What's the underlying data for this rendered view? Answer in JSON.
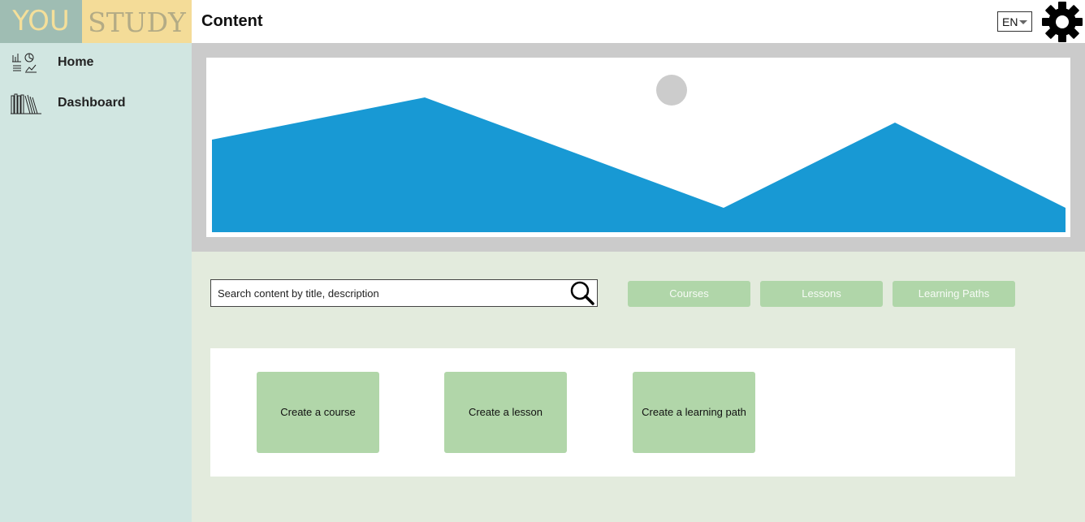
{
  "brand": {
    "part1": "YOU",
    "part2": "STUDY"
  },
  "header": {
    "title": "Content",
    "language": "EN",
    "settings_icon": "gear-icon"
  },
  "sidebar": {
    "items": [
      {
        "label": "Home",
        "icon": "home-charts-icon"
      },
      {
        "label": "Dashboard",
        "icon": "bookshelf-icon"
      }
    ]
  },
  "banner": {
    "icon": "image-placeholder-icon",
    "colors": {
      "frame": "#cbcbcb",
      "mountains": "#1899d4",
      "sun": "#cccccc"
    }
  },
  "search": {
    "placeholder": "Search content by title, description",
    "value": "",
    "icon": "search-icon"
  },
  "filters": [
    "Courses",
    "Lessons",
    "Learning Paths"
  ],
  "create_actions": [
    "Create a course",
    "Create a lesson",
    "Create a learning path"
  ],
  "colors": {
    "sidebar_bg": "#d1e6e1",
    "main_bg": "#e3ebdd",
    "button_green": "#b0d6a9",
    "logo_you_bg": "#9fbdb3",
    "logo_study_bg": "#f4dc98"
  }
}
